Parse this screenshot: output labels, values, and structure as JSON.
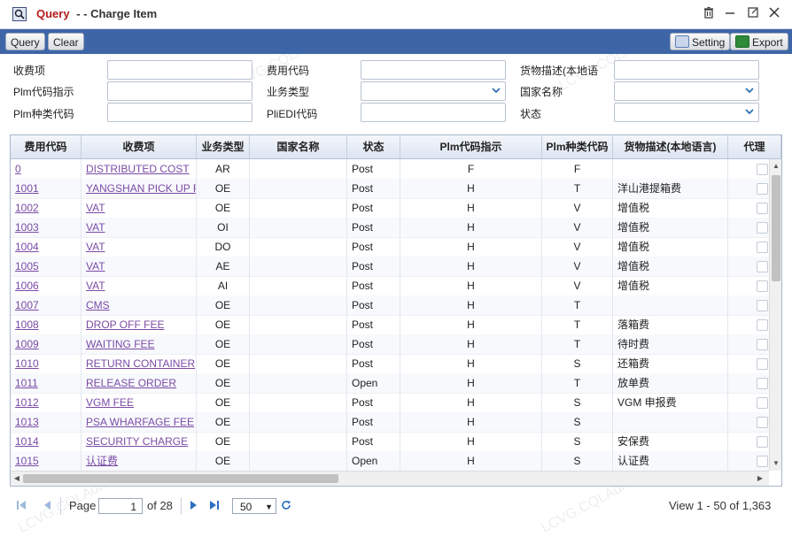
{
  "window": {
    "title_prefix": "Query",
    "title_suffix": "- - Charge Item",
    "watermark": "LCVG.CQLAdmin 2024-03-28"
  },
  "toolbar": {
    "query_label": "Query",
    "clear_label": "Clear",
    "setting_label": "Setting",
    "export_label": "Export"
  },
  "form": {
    "charge_item_label": "收费项",
    "charge_code_label": "费用代码",
    "goods_desc_label": "货物描述(本地语",
    "plm_code_label": "Plm代码指示",
    "business_type_label": "业务类型",
    "country_name_label": "国家名称",
    "plm_type_label": "Plm种类代码",
    "pliedi_label": "PliEDI代码",
    "status_label": "状态"
  },
  "grid": {
    "columns": [
      "费用代码",
      "收费项",
      "业务类型",
      "国家名称",
      "状态",
      "Plm代码指示",
      "Plm种类代码",
      "货物描述(本地语言)",
      "代理"
    ],
    "rows": [
      {
        "code": "0",
        "item": "DISTRIBUTED COST",
        "btype": "AR",
        "country": "",
        "status": "Post",
        "plm_ind": "F",
        "plm_type": "F",
        "desc": ""
      },
      {
        "code": "1001",
        "item": "YANGSHAN PICK UP F",
        "btype": "OE",
        "country": "",
        "status": "Post",
        "plm_ind": "H",
        "plm_type": "T",
        "desc": "洋山港提箱费"
      },
      {
        "code": "1002",
        "item": "VAT",
        "btype": "OE",
        "country": "",
        "status": "Post",
        "plm_ind": "H",
        "plm_type": "V",
        "desc": "增值税"
      },
      {
        "code": "1003",
        "item": "VAT",
        "btype": "OI",
        "country": "",
        "status": "Post",
        "plm_ind": "H",
        "plm_type": "V",
        "desc": "增值税"
      },
      {
        "code": "1004",
        "item": "VAT",
        "btype": "DO",
        "country": "",
        "status": "Post",
        "plm_ind": "H",
        "plm_type": "V",
        "desc": "增值税"
      },
      {
        "code": "1005",
        "item": "VAT",
        "btype": "AE",
        "country": "",
        "status": "Post",
        "plm_ind": "H",
        "plm_type": "V",
        "desc": "增值税"
      },
      {
        "code": "1006",
        "item": "VAT",
        "btype": "AI",
        "country": "",
        "status": "Post",
        "plm_ind": "H",
        "plm_type": "V",
        "desc": "增值税"
      },
      {
        "code": "1007",
        "item": "CMS",
        "btype": "OE",
        "country": "",
        "status": "Post",
        "plm_ind": "H",
        "plm_type": "T",
        "desc": ""
      },
      {
        "code": "1008",
        "item": "DROP OFF FEE",
        "btype": "OE",
        "country": "",
        "status": "Post",
        "plm_ind": "H",
        "plm_type": "T",
        "desc": "落箱费"
      },
      {
        "code": "1009",
        "item": "WAITING FEE",
        "btype": "OE",
        "country": "",
        "status": "Post",
        "plm_ind": "H",
        "plm_type": "T",
        "desc": "待时费"
      },
      {
        "code": "1010",
        "item": "RETURN CONTAINER",
        "btype": "OE",
        "country": "",
        "status": "Post",
        "plm_ind": "H",
        "plm_type": "S",
        "desc": "还箱费"
      },
      {
        "code": "1011",
        "item": "RELEASE ORDER",
        "btype": "OE",
        "country": "",
        "status": "Open",
        "plm_ind": "H",
        "plm_type": "T",
        "desc": "放单费"
      },
      {
        "code": "1012",
        "item": "VGM FEE",
        "btype": "OE",
        "country": "",
        "status": "Post",
        "plm_ind": "H",
        "plm_type": "S",
        "desc": "VGM 申报费"
      },
      {
        "code": "1013",
        "item": "PSA WHARFAGE FEE",
        "btype": "OE",
        "country": "",
        "status": "Post",
        "plm_ind": "H",
        "plm_type": "S",
        "desc": ""
      },
      {
        "code": "1014",
        "item": "SECURITY CHARGE",
        "btype": "OE",
        "country": "",
        "status": "Post",
        "plm_ind": "H",
        "plm_type": "S",
        "desc": "安保费"
      },
      {
        "code": "1015",
        "item": "认证费",
        "btype": "OE",
        "country": "",
        "status": "Open",
        "plm_ind": "H",
        "plm_type": "S",
        "desc": "认证费"
      }
    ]
  },
  "pager": {
    "page_label": "Page",
    "page_value": "1",
    "of_label": "of 28",
    "page_size": "50",
    "summary": "View 1 - 50 of 1,363"
  }
}
